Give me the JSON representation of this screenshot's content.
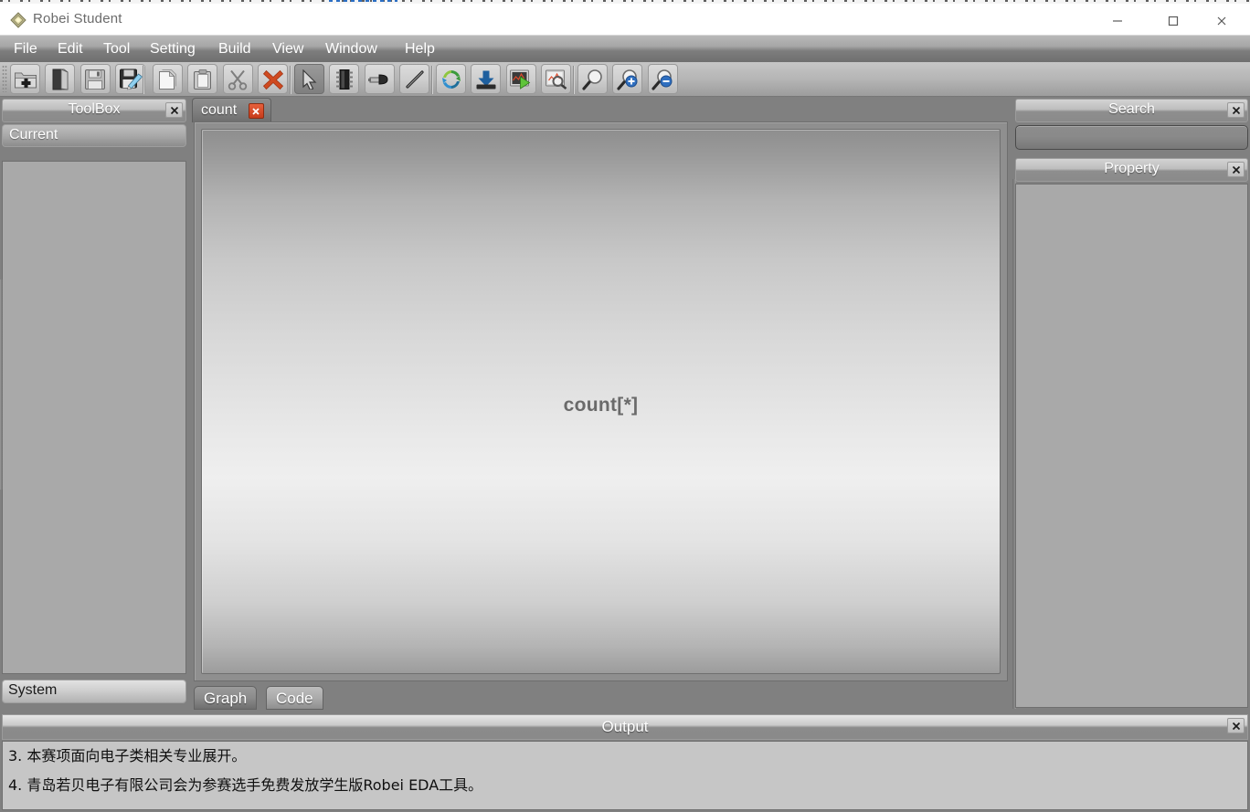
{
  "window": {
    "app_title": "Robei  Student",
    "logo_icon": "robei-diamond-logo",
    "controls": {
      "minimize": "minimize-icon",
      "maximize": "maximize-icon",
      "close": "close-icon"
    }
  },
  "menubar": {
    "items": [
      {
        "label": "File"
      },
      {
        "label": "Edit"
      },
      {
        "label": "Tool"
      },
      {
        "label": "Setting"
      },
      {
        "label": "Build"
      },
      {
        "label": "View"
      },
      {
        "label": "Window"
      },
      {
        "label": "Help"
      }
    ]
  },
  "toolbar": {
    "groups": [
      {
        "buttons": [
          {
            "name": "new-project-icon",
            "selected": false
          },
          {
            "name": "open-project-icon",
            "selected": false
          },
          {
            "name": "save-icon",
            "selected": false
          },
          {
            "name": "save-as-icon",
            "selected": false
          }
        ]
      },
      {
        "buttons": [
          {
            "name": "copy-icon",
            "selected": false
          },
          {
            "name": "paste-icon",
            "selected": false
          },
          {
            "name": "cut-scissors-icon",
            "selected": false
          },
          {
            "name": "delete-x-icon",
            "selected": false
          }
        ]
      },
      {
        "buttons": [
          {
            "name": "select-arrow-icon",
            "selected": true
          },
          {
            "name": "module-chip-icon",
            "selected": false
          },
          {
            "name": "port-plug-icon",
            "selected": false
          },
          {
            "name": "wire-line-icon",
            "selected": false
          }
        ]
      },
      {
        "buttons": [
          {
            "name": "compile-refresh-icon",
            "selected": false
          },
          {
            "name": "download-icon",
            "selected": false
          },
          {
            "name": "simulate-run-icon",
            "selected": false
          },
          {
            "name": "waveform-search-icon",
            "selected": false
          }
        ]
      },
      {
        "buttons": [
          {
            "name": "zoom-fit-icon",
            "selected": false
          },
          {
            "name": "zoom-in-icon",
            "selected": false
          },
          {
            "name": "zoom-out-icon",
            "selected": false
          }
        ]
      }
    ]
  },
  "toolbox_panel": {
    "title": "ToolBox",
    "close_icon": "close-icon",
    "current_group_label": "Current",
    "system_group_label": "System",
    "items": []
  },
  "editor": {
    "tabs": [
      {
        "label": "count",
        "close_icon": "tab-close-icon",
        "active": true
      }
    ],
    "canvas": {
      "module_label": "count[*]"
    },
    "view_tabs": [
      {
        "label": "Graph",
        "selected": true
      },
      {
        "label": "Code",
        "selected": false
      }
    ]
  },
  "search_panel": {
    "title": "Search",
    "close_icon": "close-icon",
    "input_value": "",
    "input_placeholder": ""
  },
  "property_panel": {
    "title": "Property",
    "close_icon": "close-icon",
    "rows": []
  },
  "output_panel": {
    "title": "Output",
    "close_icon": "close-icon",
    "lines": [
      "3. 本赛项面向电子类相关专业展开。",
      "4. 青岛若贝电子有限公司会为参赛选手免费发放学生版Robei EDA工具。"
    ]
  },
  "colors": {
    "chrome_gray": "#808080",
    "panel_body": "#a9a9a9",
    "accent_red": "#c73b1b",
    "menu_text": "#ffffff",
    "canvas_label": "#6a6a6a"
  }
}
